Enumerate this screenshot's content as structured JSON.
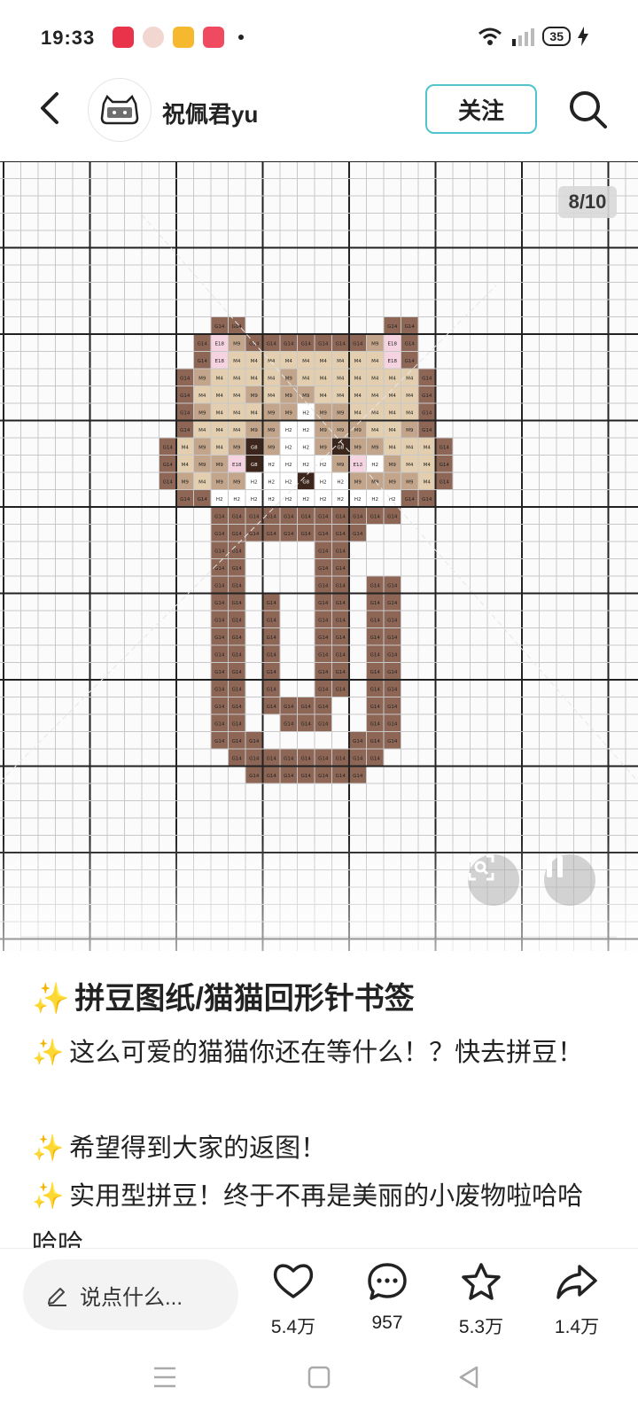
{
  "status": {
    "time": "19:33",
    "battery": "35",
    "app_icons": [
      "music-app-icon",
      "avatar-app-icon",
      "books-app-icon",
      "video-app-icon"
    ]
  },
  "header": {
    "username": "祝佩君yu",
    "follow_label": "关注"
  },
  "media": {
    "counter": "8/10",
    "pattern_legend": {
      "G14": "#8e6656",
      "M4": "#e3cfb0",
      "M9": "#c2a58a",
      "E18": "#f5d3e0",
      "H2": "#ffffff",
      "G8": "#3c261b"
    }
  },
  "post": {
    "title": "拼豆图纸/猫猫回形针书签",
    "lines": [
      "这么可爱的猫猫你还在等什么！？快去拼豆！",
      "希望得到大家的返图！",
      "实用型拼豆！终于不再是美丽的小废物啦哈哈哈哈"
    ]
  },
  "bottom": {
    "comment_placeholder": "说点什么...",
    "likes": "5.4万",
    "comments": "957",
    "collects": "5.3万",
    "shares": "1.4万"
  }
}
